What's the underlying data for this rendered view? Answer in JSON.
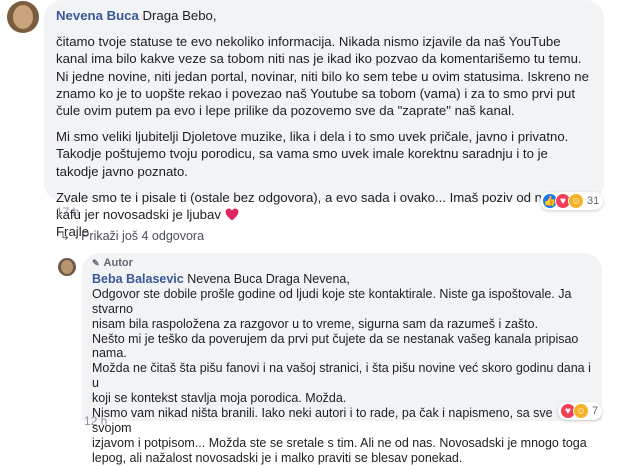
{
  "comment1": {
    "author": "Nevena Buca",
    "greeting": "Draga Bebo,",
    "paragraph1": "čitamo tvoje statuse te evo nekoliko informacija. Nikada nismo izjavile da naš YouTube kanal ima bilo kakve veze sa tobom niti nas je ikad iko pozvao da komentarišemo tu temu. Ni jedne novine, niti jedan portal, novinar, niti bilo ko sem tebe u ovim statusima. Iskreno ne znamo ko je to uopšte rekao i povezao naš Youtube sa tobom (vama) i za to smo prvi put čule ovim putem pa evo i lepe prilike da pozovemo sve da \"zaprate\" naš kanal.",
    "paragraph2": "Mi smo veliki ljubitelji Djoletove muzike, lika i dela i to smo uvek pričale, javno i privatno. Takodje poštujemo tvoju porodicu, sa vama smo uvek imale korektnu saradnju i to je takodje javno poznato.",
    "paragraph3_line1": "Zvale smo te i pisale ti (ostale bez odgovora), a evo sada i ovako... Imaš poziv od nas za kafu jer novosadski je ljubav",
    "signature": "Frajle",
    "time": "17 h",
    "reaction_count": "31",
    "reaction_icons": [
      "like-icon",
      "love-icon",
      "haha-icon"
    ]
  },
  "more_replies": "Prikaži još 4 odgovora",
  "comment2": {
    "badge": "Autor",
    "author": "Beba Balasevic",
    "mention": "Nevena Buca Draga Nevena,",
    "lines": [
      "Odgovor ste dobile prošle godine od ljudi koje ste kontaktirale. Niste ga ispoštovale. Ja stvarno",
      "nisam bila raspoložena za razgovor u to vreme, sigurna sam da razumeš i zašto.",
      "Nešto mi je teško da poverujem da prvi put čujete da se nestanak vašeg kanala pripisao nama.",
      "Možda ne čitaš šta pišu fanovi i na vašoj stranici, i šta pišu novine već skoro godinu dana i u",
      "koji se kontekst stavlja moja porodica. Možda.",
      "Nismo vam nikad ništa branili. Iako neki autori i to rade, pa čak i napismeno, sa sve svojom",
      "izjavom i potpisom... Možda ste se sretale s tim. Ali ne od nas. Novosadski je mnogo toga",
      "lepog, ali nažalost novosadski je i malko praviti se blesav ponekad."
    ],
    "time": "12 h",
    "reaction_count": "7",
    "reaction_icons": [
      "love-icon",
      "haha-icon"
    ]
  }
}
